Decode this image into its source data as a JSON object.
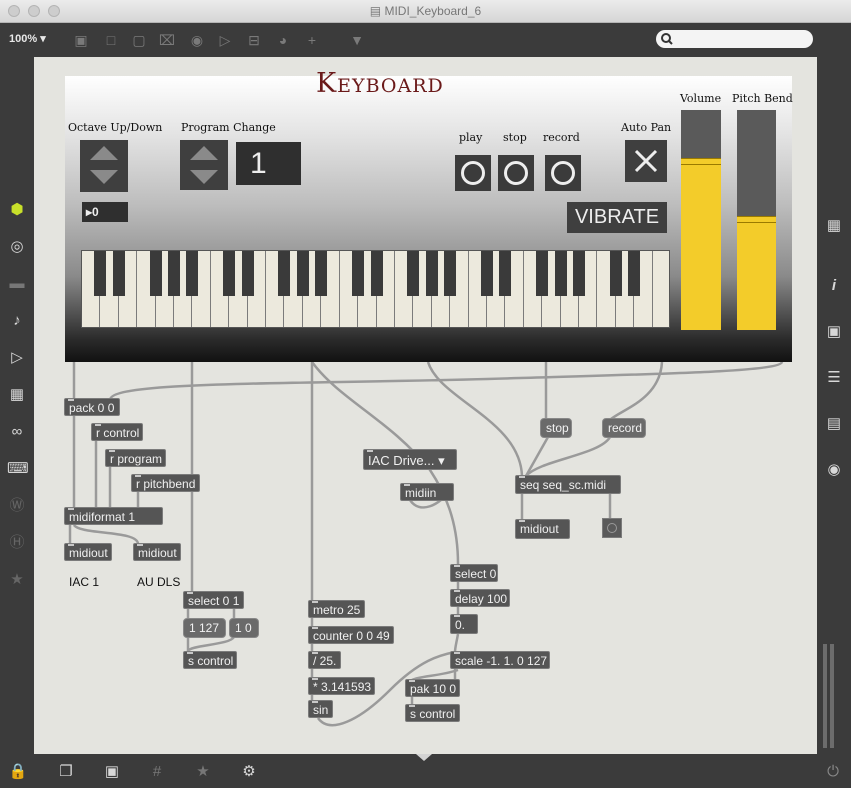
{
  "window": {
    "title": "MIDI_Keyboard_6"
  },
  "toolbar": {
    "zoom": "100% ▾"
  },
  "panel": {
    "title": "Keyboard",
    "octave_label": "Octave Up/Down",
    "octave_value": "▸0",
    "program_label": "Program Change",
    "program_value": "1",
    "play_label": "play",
    "stop_label": "stop",
    "record_label": "record",
    "autopan_label": "Auto Pan",
    "vibrate_label": "VIBRATE",
    "volume_label": "Volume",
    "pitchbend_label": "Pitch Bend",
    "volume_level": 0.78,
    "pitchbend_level": 0.52
  },
  "objects": {
    "pack": "pack 0 0",
    "r_control": "r control",
    "r_program": "r program",
    "r_pitchbend": "r pitchbend",
    "midiformat": "midiformat 1",
    "midiout1": "midiout",
    "midiout2": "midiout",
    "iac1": "IAC 1",
    "audls": "AU DLS",
    "select01": "select 0 1",
    "msg_1127": "1 127",
    "msg_10": "1 0",
    "s_control1": "s control",
    "metro": "metro 25",
    "counter": "counter 0 0 49",
    "div": "/ 25.",
    "mul": "* 3.141593",
    "sin": "sin",
    "iac_menu": "IAC Drive... ▾",
    "midiin": "midiin",
    "select0": "select 0",
    "delay": "delay 100",
    "float_box": "0.",
    "scale": "scale -1. 1. 0 127",
    "pak": "pak 10 0",
    "s_control2": "s control",
    "stop_msg": "stop",
    "record_msg": "record",
    "seq": "seq seq_sc.midi",
    "midiout3": "midiout"
  }
}
